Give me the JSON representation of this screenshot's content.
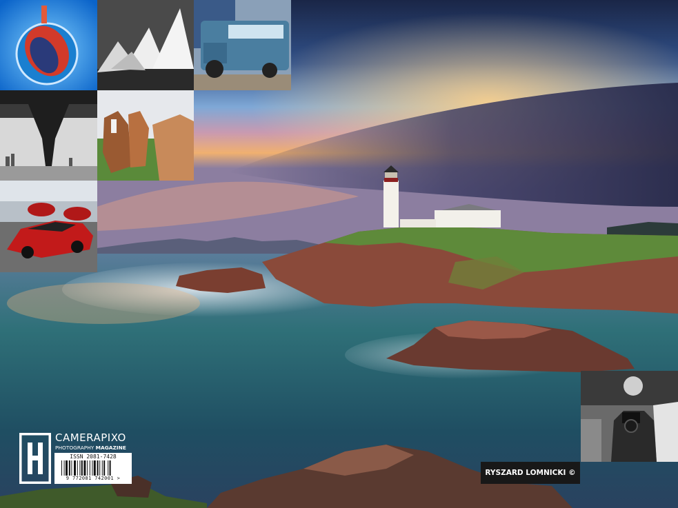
{
  "logo": {
    "brand": "CAMERAPIXO",
    "tagline_regular": "PHOTOGRAPHY ",
    "tagline_bold": "MAGAZINE",
    "issn": "ISSN 2081-7428",
    "barcode_number": "9 772081 742001 >"
  },
  "credit": {
    "text": "RYSZARD LOMNICKI  ©"
  },
  "colors": {
    "sky_top": "#1b2a4a",
    "sky_horizon": "#f2a45c",
    "sea": "#2f6f78",
    "credit_bg": "#181818"
  },
  "icons": {
    "logo_mark": "camerapixo-logo-icon"
  }
}
